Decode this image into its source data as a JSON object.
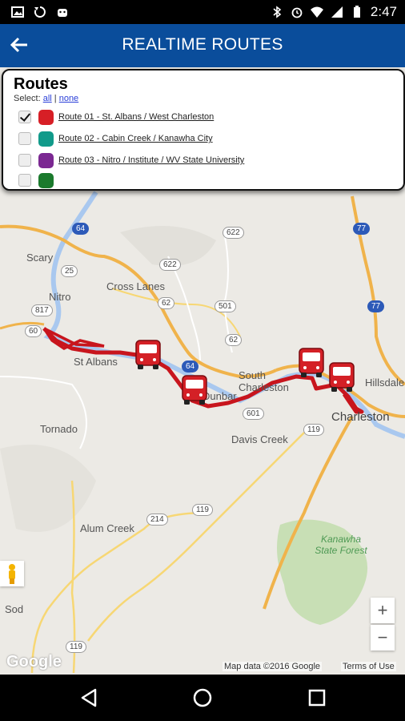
{
  "status_bar": {
    "time": "2:47"
  },
  "header": {
    "title": "REALTIME ROUTES"
  },
  "routes_panel": {
    "title": "Routes",
    "select_label": "Select:",
    "select_all": "all",
    "separator": "|",
    "select_none": "none",
    "routes": [
      {
        "label": "Route 01 - St. Albans / West Charleston",
        "checked": true,
        "color": "#d71f26"
      },
      {
        "label": "Route 02 - Cabin Creek / Kanawha City",
        "checked": false,
        "color": "#119a8a"
      },
      {
        "label": "Route 03 - Nitro / Institute / WV State University",
        "checked": false,
        "color": "#7b2892"
      }
    ]
  },
  "map": {
    "places": [
      "Scary",
      "Cross Lanes",
      "Nitro",
      "St Albans",
      "South Charleston",
      "Dunbar",
      "Charleston",
      "Hillsdale",
      "Tornado",
      "Davis Creek",
      "Alum Creek",
      "Kanawha State Forest",
      "Sod"
    ],
    "highway_shields": [
      "622",
      "64",
      "25",
      "622",
      "817",
      "62",
      "501",
      "60",
      "62",
      "64",
      "601",
      "119",
      "214",
      "119",
      "119",
      "77",
      "77"
    ],
    "zoom_in": "+",
    "zoom_out": "−",
    "attribution": "Map data ©2016 Google",
    "terms": "Terms of Use",
    "logo": "Google"
  },
  "colors": {
    "header": "#0a4d9b",
    "route_line": "#c8151d",
    "bus": "#d42026"
  }
}
